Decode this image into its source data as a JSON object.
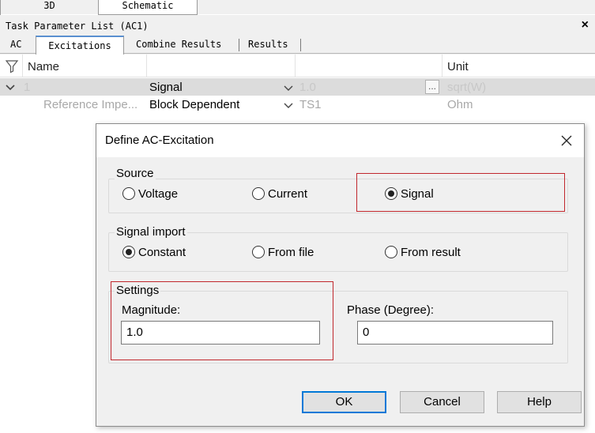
{
  "view_tabs": [
    {
      "label": "3D"
    },
    {
      "label": "Schematic"
    }
  ],
  "panel": {
    "title": "Task Parameter List (AC1)",
    "close_glyph": "×"
  },
  "sub_tabs": [
    {
      "label": "AC"
    },
    {
      "label": "Excitations"
    },
    {
      "label": "Combine Results"
    },
    {
      "label": "Results"
    }
  ],
  "grid": {
    "columns": {
      "name": "Name",
      "unit": "Unit"
    },
    "rows": [
      {
        "name": "1",
        "type": "Signal",
        "value": "1.0",
        "unit": "sqrt(W)"
      },
      {
        "name": "Reference Impe...",
        "type": "Block Dependent",
        "value": "TS1",
        "unit": "Ohm"
      }
    ]
  },
  "dialog": {
    "title": "Define AC-Excitation",
    "source": {
      "label": "Source",
      "options": [
        "Voltage",
        "Current",
        "Signal"
      ],
      "selected": "Signal"
    },
    "signal_import": {
      "label": "Signal import",
      "options": [
        "Constant",
        "From file",
        "From result"
      ],
      "selected": "Constant"
    },
    "settings": {
      "label": "Settings",
      "magnitude_label": "Magnitude:",
      "magnitude_value": "1.0",
      "phase_label": "Phase (Degree):",
      "phase_value": "0"
    },
    "buttons": {
      "ok": "OK",
      "cancel": "Cancel",
      "help": "Help"
    }
  },
  "colors": {
    "highlight": "#c1272d",
    "default_button": "#0078d7"
  }
}
